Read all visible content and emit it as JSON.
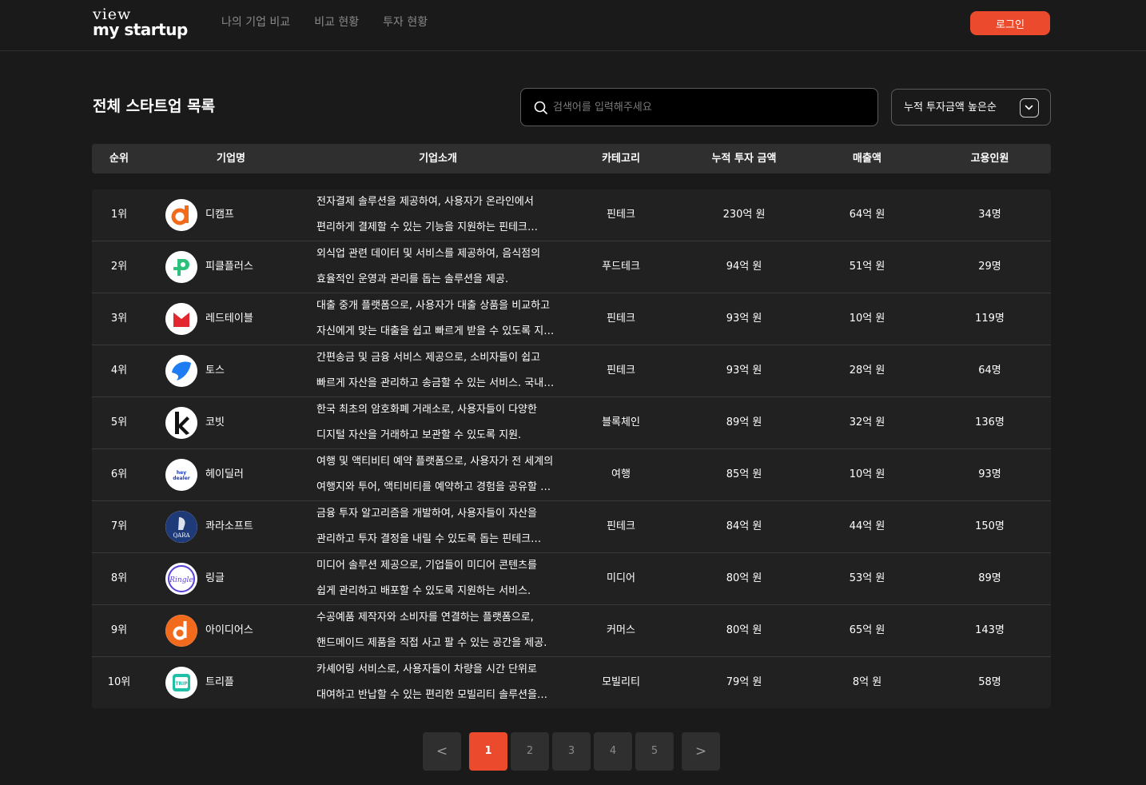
{
  "header": {
    "logo_top": "view",
    "logo_bottom": "my startup",
    "nav": [
      "나의 기업 비교",
      "비교 현황",
      "투자 현황"
    ],
    "login_label": "로그인"
  },
  "main": {
    "title": "전체 스타트업 목록",
    "search_placeholder": "검색어를 입력해주세요",
    "sort_label": "누적 투자금액 높은순"
  },
  "table": {
    "columns": [
      "순위",
      "기업명",
      "기업소개",
      "카테고리",
      "누적 투자 금액",
      "매출액",
      "고용인원"
    ],
    "rows": [
      {
        "rank": "1위",
        "name": "디캠프",
        "desc1": "전자결제 솔루션을 제공하여, 사용자가 온라인에서",
        "desc2": "편리하게 결제할 수 있는 기능을 지원하는 핀테크…",
        "category": "핀테크",
        "investment": "230억 원",
        "revenue": "64억 원",
        "employees": "34명",
        "logo": "dcamp-logo"
      },
      {
        "rank": "2위",
        "name": "피클플러스",
        "desc1": "외식업 관련 데이터 및 서비스를 제공하여, 음식점의",
        "desc2": "효율적인 운영과 관리를 돕는 솔루션을 제공.",
        "category": "푸드테크",
        "investment": "94억 원",
        "revenue": "51억 원",
        "employees": "29명",
        "logo": "pickleplus-logo"
      },
      {
        "rank": "3위",
        "name": "레드테이블",
        "desc1": "대출 중개 플랫폼으로, 사용자가 대출 상품을 비교하고",
        "desc2": "자신에게 맞는 대출을 쉽고 빠르게 받을 수 있도록 지원.",
        "category": "핀테크",
        "investment": "93억 원",
        "revenue": "10억 원",
        "employees": "119명",
        "logo": "redtable-logo"
      },
      {
        "rank": "4위",
        "name": "토스",
        "desc1": "간편송금 및 금융 서비스 제공으로, 소비자들이 쉽고",
        "desc2": "빠르게 자산을 관리하고 송금할 수 있는 서비스. 국내…",
        "category": "핀테크",
        "investment": "93억 원",
        "revenue": "28억 원",
        "employees": "64명",
        "logo": "toss-logo"
      },
      {
        "rank": "5위",
        "name": "코빗",
        "desc1": "한국 최초의 암호화폐 거래소로, 사용자들이 다양한",
        "desc2": "디지털 자산을 거래하고 보관할 수 있도록 지원.",
        "category": "블록체인",
        "investment": "89억 원",
        "revenue": "32억 원",
        "employees": "136명",
        "logo": "korbit-logo"
      },
      {
        "rank": "6위",
        "name": "헤이딜러",
        "desc1": "여행 및 액티비티 예약 플랫폼으로, 사용자가 전 세계의",
        "desc2": "여행지와 투어, 액티비티를 예약하고 경험을 공유할 …",
        "category": "여행",
        "investment": "85억 원",
        "revenue": "10억 원",
        "employees": "93명",
        "logo": "heydealer-logo"
      },
      {
        "rank": "7위",
        "name": "콰라소프트",
        "desc1": "금융 투자 알고리즘을 개발하여, 사용자들이 자산을",
        "desc2": "관리하고 투자 결정을 내릴 수 있도록 돕는 핀테크…",
        "category": "핀테크",
        "investment": "84억 원",
        "revenue": "44억 원",
        "employees": "150명",
        "logo": "qara-logo"
      },
      {
        "rank": "8위",
        "name": "링글",
        "desc1": "미디어 솔루션 제공으로, 기업들이 미디어 콘텐츠를",
        "desc2": "쉽게 관리하고 배포할 수 있도록 지원하는 서비스.",
        "category": "미디어",
        "investment": "80억 원",
        "revenue": "53억 원",
        "employees": "89명",
        "logo": "ringle-logo"
      },
      {
        "rank": "9위",
        "name": "아이디어스",
        "desc1": "수공예품 제작자와 소비자를 연결하는 플랫폼으로,",
        "desc2": "핸드메이드 제품을 직접 사고 팔 수 있는 공간을 제공.",
        "category": "커머스",
        "investment": "80억 원",
        "revenue": "65억 원",
        "employees": "143명",
        "logo": "idus-logo"
      },
      {
        "rank": "10위",
        "name": "트리플",
        "desc1": "카셰어링 서비스로, 사용자들이 차량을 시간 단위로",
        "desc2": "대여하고 반납할 수 있는 편리한 모빌리티 솔루션을…",
        "category": "모빌리티",
        "investment": "79억 원",
        "revenue": "8억 원",
        "employees": "58명",
        "logo": "triple-logo"
      }
    ]
  },
  "logo_text": {
    "heydealer_1": "hey",
    "heydealer_2": "dealer",
    "qara": "QARA",
    "ringle": "Ringle",
    "triple": "TRIP"
  },
  "pagination": {
    "prev": "<",
    "next": ">",
    "pages": [
      "1",
      "2",
      "3",
      "4",
      "5"
    ],
    "current": "1"
  },
  "colors": {
    "accent": "#eb4b2c",
    "background": "#1a1a1a",
    "row_background": "#212121",
    "header_background": "#2f2f2f"
  }
}
